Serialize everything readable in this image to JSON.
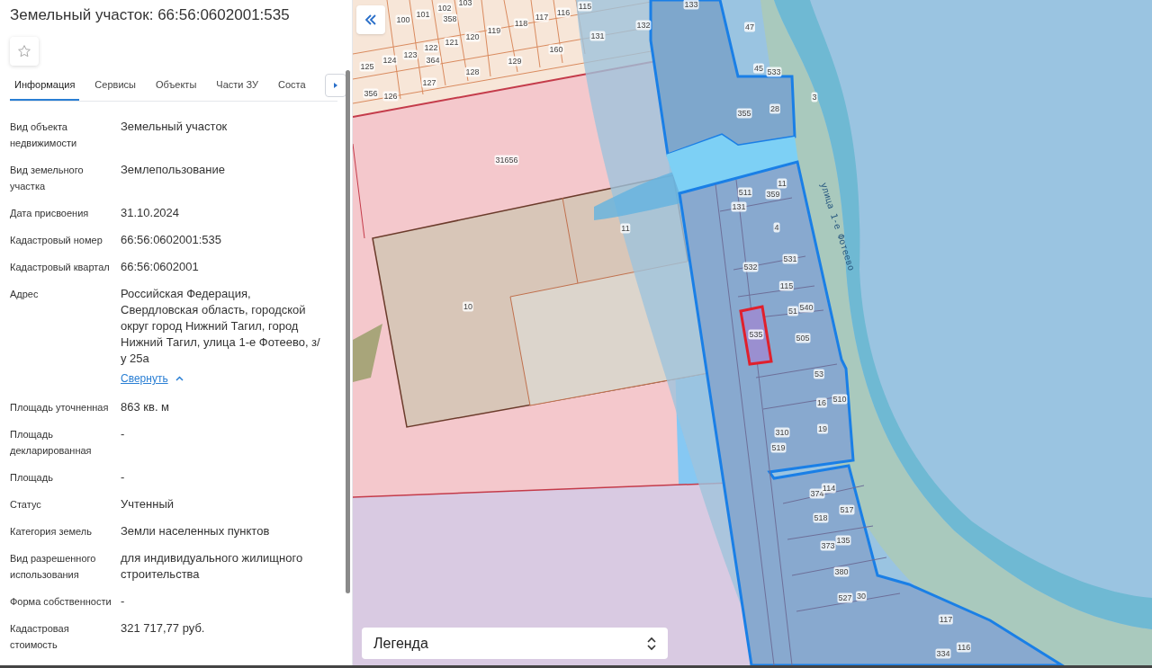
{
  "panel": {
    "title": "Земельный участок: 66:56:0602001:535",
    "tabs": [
      {
        "label": "Информация",
        "selected": true
      },
      {
        "label": "Сервисы",
        "selected": false
      },
      {
        "label": "Объекты",
        "selected": false
      },
      {
        "label": "Части ЗУ",
        "selected": false
      },
      {
        "label": "Соста",
        "selected": false
      }
    ],
    "fields": [
      {
        "label": "Вид объекта недвижимости",
        "value": "Земельный участок"
      },
      {
        "label": "Вид земельного участка",
        "value": "Землепользование"
      },
      {
        "label": "Дата присвоения",
        "value": "31.10.2024"
      },
      {
        "label": "Кадастровый номер",
        "value": "66:56:0602001:535"
      },
      {
        "label": "Кадастровый квартал",
        "value": "66:56:0602001"
      },
      {
        "label": "Адрес",
        "value": "Российская Федерация, Свердловская область, городской округ город Нижний Тагил, город Нижний Тагил, улица 1-е Фотеево, з/у 25а",
        "toggle": {
          "label": "Свернуть",
          "expanded": true
        }
      },
      {
        "label": "Площадь уточненная",
        "value": "863 кв. м"
      },
      {
        "label": "Площадь декларированная",
        "value": "-"
      },
      {
        "label": "Площадь",
        "value": "-"
      },
      {
        "label": "Статус",
        "value": "Учтенный"
      },
      {
        "label": "Категория земель",
        "value": "Земли населенных пунктов"
      },
      {
        "label": "Вид разрешенного использования",
        "value": "для индивидуального жилищного строительства"
      },
      {
        "label": "Форма собственности",
        "value": "-"
      },
      {
        "label": "Кадастровая стоимость",
        "value": "321 717,77 руб."
      }
    ]
  },
  "map": {
    "parcel_labels": [
      {
        "text": "100"
      },
      {
        "text": "101"
      },
      {
        "text": "102"
      },
      {
        "text": "358"
      },
      {
        "text": "103"
      },
      {
        "text": "118"
      },
      {
        "text": "117"
      },
      {
        "text": "116"
      },
      {
        "text": "115"
      },
      {
        "text": "133"
      },
      {
        "text": "132"
      },
      {
        "text": "131"
      },
      {
        "text": "160"
      },
      {
        "text": "119"
      },
      {
        "text": "120"
      },
      {
        "text": "121"
      },
      {
        "text": "122"
      },
      {
        "text": "364"
      },
      {
        "text": "123"
      },
      {
        "text": "124"
      },
      {
        "text": "125"
      },
      {
        "text": "129"
      },
      {
        "text": "128"
      },
      {
        "text": "127"
      },
      {
        "text": "356"
      },
      {
        "text": "126"
      },
      {
        "text": "47"
      },
      {
        "text": "45"
      },
      {
        "text": "533"
      },
      {
        "text": "3"
      },
      {
        "text": "355"
      },
      {
        "text": "28"
      },
      {
        "text": "11"
      },
      {
        "text": "359"
      },
      {
        "text": "511"
      },
      {
        "text": "131"
      },
      {
        "text": "4"
      },
      {
        "text": "531"
      },
      {
        "text": "532"
      },
      {
        "text": "115"
      },
      {
        "text": "51"
      },
      {
        "text": "540"
      },
      {
        "text": "535"
      },
      {
        "text": "505"
      },
      {
        "text": "53"
      },
      {
        "text": "16"
      },
      {
        "text": "510"
      },
      {
        "text": "310"
      },
      {
        "text": "519"
      },
      {
        "text": "19"
      },
      {
        "text": "374"
      },
      {
        "text": "114"
      },
      {
        "text": "517"
      },
      {
        "text": "518"
      },
      {
        "text": "373"
      },
      {
        "text": "135"
      },
      {
        "text": "380"
      },
      {
        "text": "527"
      },
      {
        "text": "30"
      },
      {
        "text": "117"
      },
      {
        "text": "334"
      },
      {
        "text": "116"
      },
      {
        "text": "31656"
      },
      {
        "text": "11"
      },
      {
        "text": "10"
      }
    ],
    "street_label": "улица 1-е Фотеево",
    "legend": {
      "label": "Легенда"
    }
  }
}
